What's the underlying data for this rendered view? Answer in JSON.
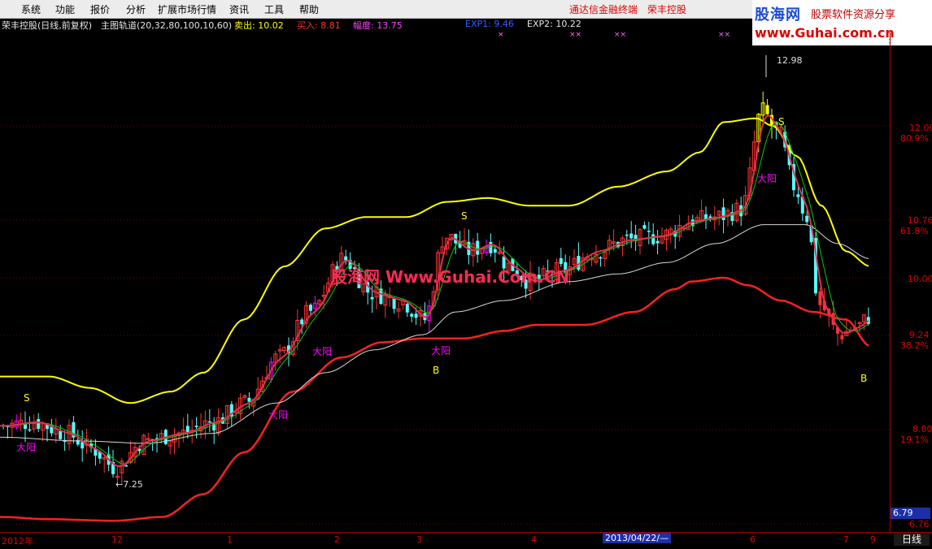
{
  "menu": {
    "items": [
      "系统",
      "功能",
      "报价",
      "分析",
      "扩展市场行情",
      "资讯",
      "工具",
      "帮助"
    ],
    "terminal_name": "通达信金融终端",
    "stock_name": "荣丰控股"
  },
  "logo": {
    "cn": "股海网",
    "sub": "股票软件资源分享",
    "url": "www.Guhai.com.cn"
  },
  "info": {
    "title": "荣丰控股(日线,前复权)",
    "indicator": "主图轨道(20,32,80,100,10,60)",
    "sell_label": "卖出: 10.02",
    "buy_label": "买入: 8.81",
    "amplitude_label": "幅度: 13.75",
    "exp1_label": "EXP1: 9.46",
    "exp2_label": "EXP2: 10.22"
  },
  "price_axis": {
    "labels": [
      "12.00",
      "80.9%",
      "10.76",
      "61.8%",
      "10.00",
      "9.24",
      "38.2%",
      "8.00",
      "19.1%",
      "6.76"
    ],
    "current_price": "6.79"
  },
  "time_axis": {
    "labels": [
      "2012年",
      "12",
      "1",
      "2",
      "3",
      "4",
      "6",
      "7",
      "9"
    ],
    "selected_date": "2013/04/22/—",
    "timeframe": "日线"
  },
  "annotations": {
    "high_label": "12.98",
    "low_label": "←7.25",
    "big_yang": "大阳",
    "signal_s": "S",
    "signal_b": "B"
  },
  "watermark": "股海网 Www.Guhai.Com.CN",
  "colors": {
    "up": "#ff3232",
    "down": "#54ffff",
    "upper_band": "#ffff00",
    "lower_band": "#ff2020",
    "mid_line": "#d8d8d8",
    "ma_green": "#00cc00",
    "highlight": "#ff00ff",
    "peak": "#ffff00"
  }
}
